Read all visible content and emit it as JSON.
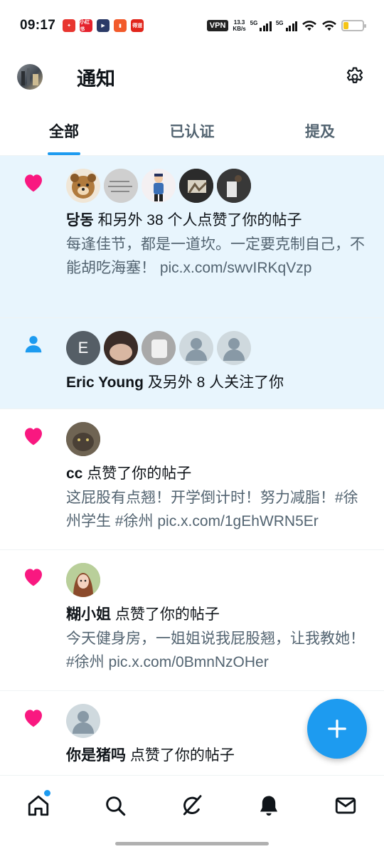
{
  "status": {
    "time": "09:17",
    "vpn": "VPN",
    "speed_value": "13.3",
    "speed_unit": "KB/s",
    "net1": "5G",
    "net2": "5G",
    "app_icons": [
      {
        "name": "app-icon-1",
        "color": "#e8352f",
        "label": ""
      },
      {
        "name": "app-icon-2",
        "color": "#e5222d",
        "label": "小红书"
      },
      {
        "name": "app-icon-3",
        "color": "#2b3a67",
        "label": "▶"
      },
      {
        "name": "app-icon-4",
        "color": "#f25a2b",
        "label": ""
      },
      {
        "name": "app-icon-5",
        "color": "#e1251b",
        "label": "得道"
      }
    ],
    "battery_level": 0.25
  },
  "header": {
    "title": "通知",
    "settings_icon": "gear-icon"
  },
  "tabs": [
    {
      "label": "全部",
      "active": true
    },
    {
      "label": "已认证",
      "active": false
    },
    {
      "label": "提及",
      "active": false
    }
  ],
  "notifications": [
    {
      "type": "like",
      "icon": "heart-icon",
      "unread": true,
      "actor": "당동",
      "action": " 和另外 38 个人点赞了你的帖子",
      "snippet": "每逢佳节，都是一道坎。一定要克制自己，不能胡吃海塞！ pic.x.com/swvIRKqVzp"
    },
    {
      "type": "follow",
      "icon": "person-icon",
      "unread": true,
      "actor": "Eric Young",
      "action": " 及另外 8 人关注了你",
      "snippet": "",
      "letter_avatar": "E"
    },
    {
      "type": "like",
      "icon": "heart-icon",
      "unread": false,
      "actor": "cc",
      "action": " 点赞了你的帖子",
      "snippet": "这屁股有点翘！开学倒计时！努力减脂！#徐州学生 #徐州 pic.x.com/1gEhWRN5Er"
    },
    {
      "type": "like",
      "icon": "heart-icon",
      "unread": false,
      "actor": "糊小姐",
      "action": " 点赞了你的帖子",
      "snippet": "今天健身房，一姐姐说我屁股翘，让我教她！#徐州 pic.x.com/0BmnNzOHer"
    },
    {
      "type": "like",
      "icon": "heart-icon",
      "unread": false,
      "actor": "你是猪吗",
      "action": " 点赞了你的帖子",
      "snippet": ""
    }
  ],
  "nav": {
    "items": [
      "home-icon",
      "search-icon",
      "grok-icon",
      "bell-icon",
      "mail-icon"
    ],
    "active": "bell-icon"
  },
  "colors": {
    "accent": "#1d9bf0",
    "heart": "#f91880",
    "unread_bg": "#e8f5fd"
  }
}
